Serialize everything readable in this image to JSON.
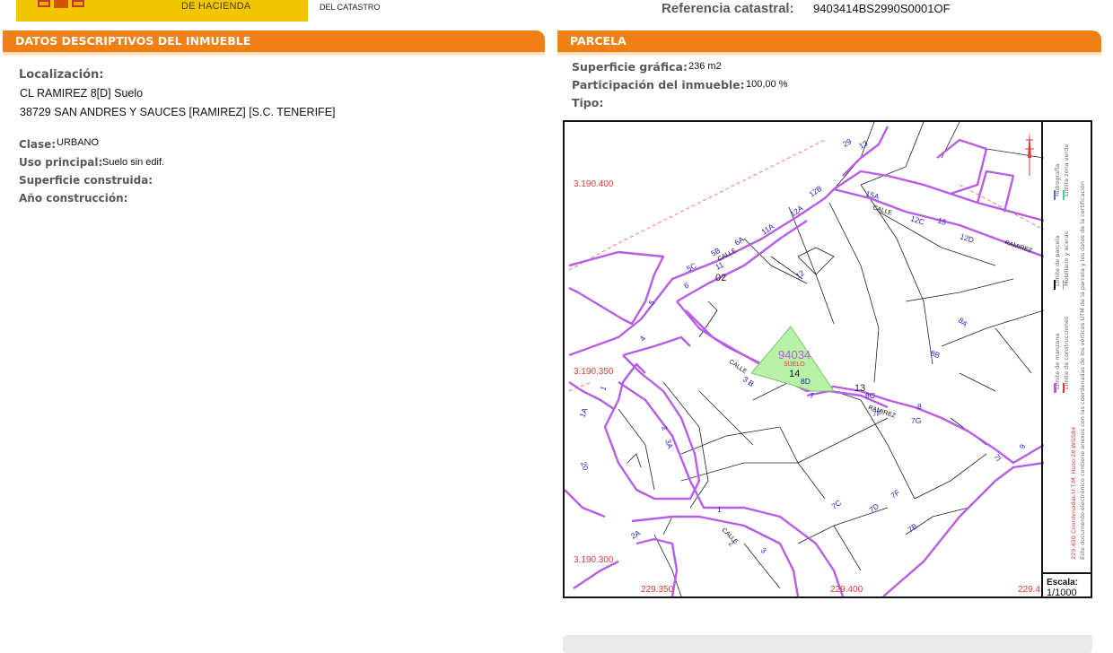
{
  "header": {
    "ministry_text": "DE HACIENDA",
    "catastro_text": "DEL CATASTRO",
    "reference_label": "Referencia catastral:",
    "reference_value": "9403414BS2990S0001OF"
  },
  "left": {
    "section_title": "DATOS DESCRIPTIVOS DEL INMUEBLE",
    "location_label": "Localización:",
    "address_line1": "CL RAMIREZ 8[D] Suelo",
    "address_line2": "38729 SAN ANDRES Y SAUCES [RAMIREZ] [S.C. TENERIFE]",
    "clase_label": "Clase:",
    "clase_value": "URBANO",
    "uso_label": "Uso principal:",
    "uso_value": "Suelo sin edif.",
    "superficie_label": "Superficie construida:",
    "anio_label": "Año construcción:"
  },
  "right": {
    "section_title": "PARCELA",
    "superficie_grafica_label": "Superficie gráfica:",
    "superficie_grafica_value": "236 m2",
    "participacion_label": "Participación del inmueble:",
    "participacion_value": "100,00 %",
    "tipo_label": "Tipo:"
  },
  "map": {
    "y_coords": [
      "3.190.400",
      "3.190.350",
      "3.190.300"
    ],
    "x_coords": [
      "229.350",
      "229.400",
      "229.4"
    ],
    "parcel_number": "94034",
    "parcel_sublabel": "SUELO",
    "parcel_sub_number": "14",
    "block_labels": [
      "02",
      "13"
    ],
    "street_labels": [
      "CALLE",
      "CALLE",
      "CALLE",
      "RAMIREZ",
      "RAMIREZ",
      "CALLE"
    ],
    "house_numbers": [
      "29",
      "13",
      "15A",
      "12B",
      "12C",
      "15",
      "12D",
      "12A",
      "11A",
      "6A",
      "5B",
      "11",
      "5C",
      "6",
      "12",
      "5",
      "4",
      "3 B",
      "8D",
      "7",
      "8C",
      "7F",
      "7G",
      "8",
      "8B",
      "8A",
      "1",
      "1A",
      "3A",
      "2",
      "20",
      "7C",
      "7D",
      "7F",
      "7B",
      "2A",
      "1",
      "2",
      "3",
      "7I",
      "9"
    ],
    "scale_label": "Escala:",
    "scale_value": "1/1000",
    "legend_texts": [
      "Límite de manzana",
      "Límite de construcciones",
      "Límite de parcela",
      "Mobiliario y aceras",
      "Hidrografía",
      "Límite zona verde",
      "229.450 Coordenadas U.T.M. Huso 28 WGS84",
      "Este documento electrónico contiene anexos con las coordenadas de los vértices UTM de la parcela y los datos de la certificación"
    ],
    "colors": {
      "block_outline": "#b65ee6",
      "parcel_fill": "#b8f2a8",
      "coord_text": "#e23a3a",
      "house_number": "#2323c8",
      "construction": "#111111"
    }
  }
}
